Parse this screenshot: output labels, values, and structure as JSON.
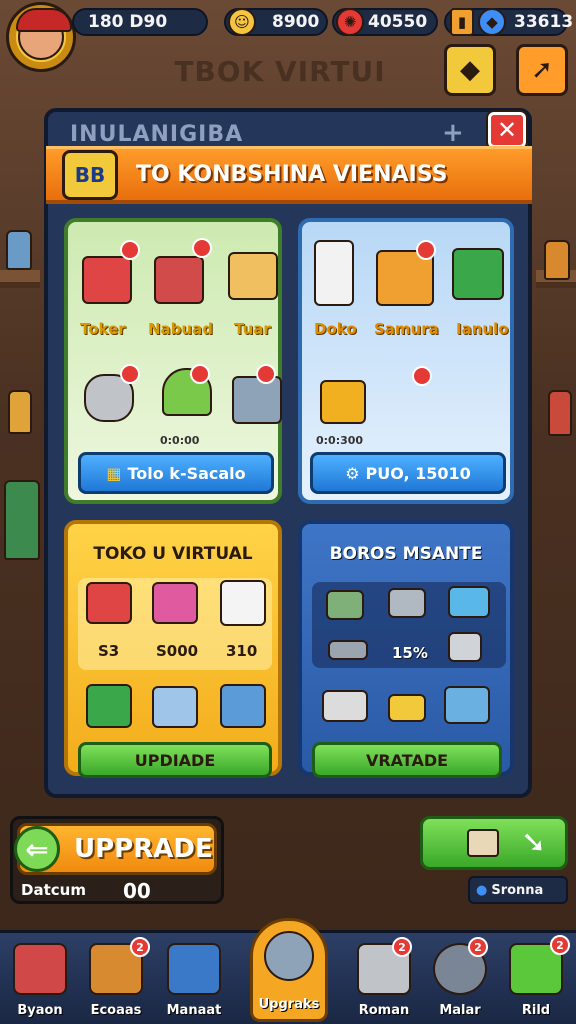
{
  "topbar": {
    "level": "180 D90",
    "coins": "8900",
    "gems": "40550",
    "cards": "33613"
  },
  "sign": "TBOK VIRTUI",
  "panel": {
    "title": "INULANIGIBA",
    "banner_icon": "BB",
    "banner_title": "TO KONBSHINA VIENAISS"
  },
  "shop_green": {
    "items": [
      "Toker",
      "Nabuad",
      "Tuar"
    ],
    "timer": "0:0:00",
    "button": "Tolo k-Sacalo"
  },
  "shop_blue": {
    "items": [
      "Doko",
      "Samura",
      "Ianulo"
    ],
    "price": "0:0:300",
    "button": "PUO, 15010"
  },
  "virtual_store": {
    "title": "TOKO U VIRTUAL",
    "prices": [
      "S3",
      "S000",
      "310"
    ],
    "button": "UPDIADE"
  },
  "bonus": {
    "title": "BOROS MSANTE",
    "percent": "15%",
    "button": "VRATADE"
  },
  "upgrade": {
    "label": "UPPRADE",
    "sub_label": "Datcum",
    "value": "00"
  },
  "side": {
    "status": "Sronna"
  },
  "nav": [
    "Byaon",
    "Ecoaas",
    "Manaat",
    "Upgraks",
    "Roman",
    "Malar",
    "Rild"
  ],
  "nav_badges": [
    "2",
    "2",
    "2",
    "2"
  ],
  "colors": {
    "accent": "#f5a623",
    "panel": "#24375a",
    "banner": "#ff9c2a"
  }
}
